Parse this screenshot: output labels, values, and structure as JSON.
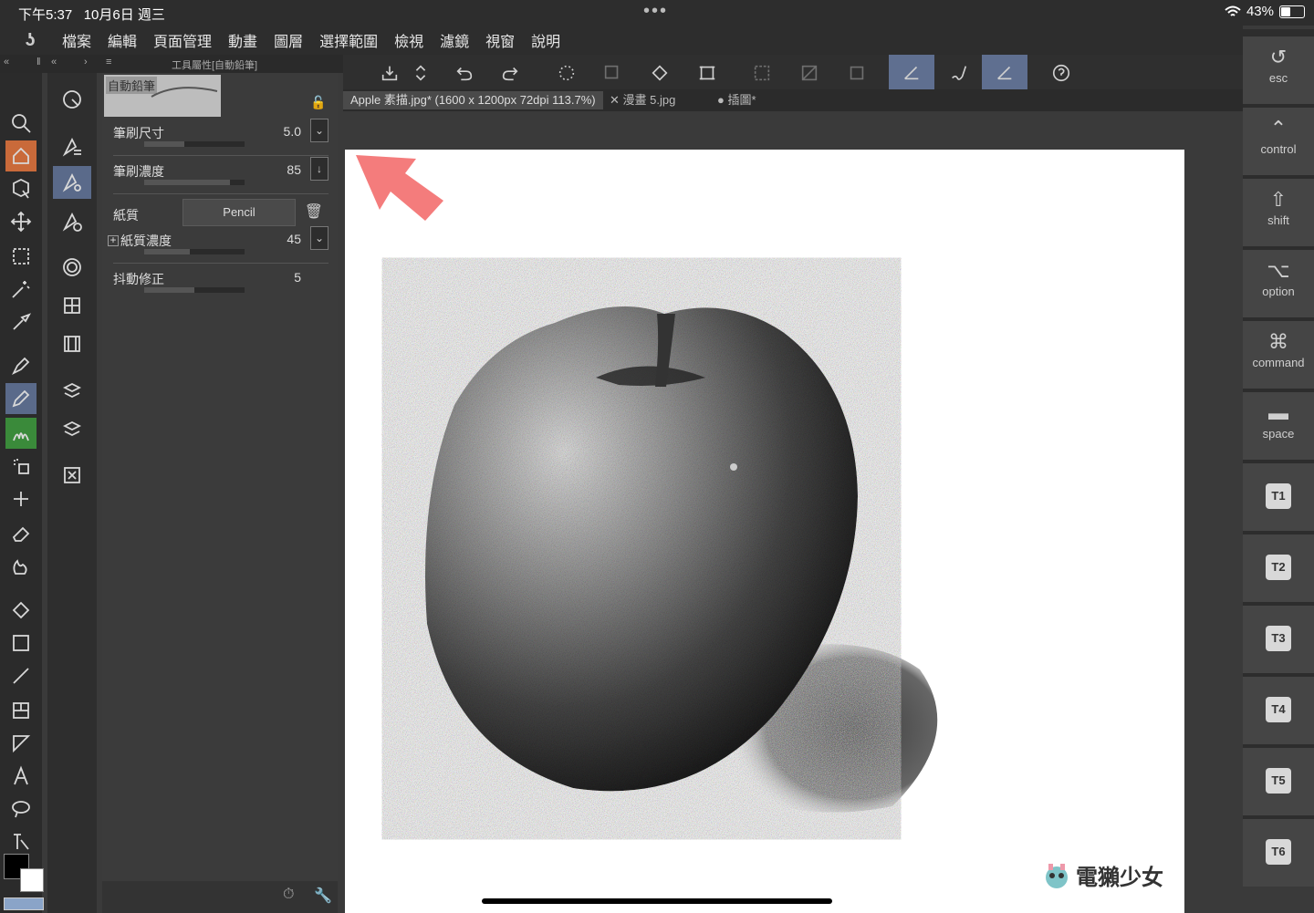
{
  "status_bar": {
    "time": "下午5:37",
    "date": "10月6日 週三",
    "battery": "43%"
  },
  "menu": [
    "檔案",
    "編輯",
    "頁面管理",
    "動畫",
    "圖層",
    "選擇範圍",
    "檢視",
    "濾鏡",
    "視窗",
    "說明"
  ],
  "tool_property": {
    "header": "工具屬性[自動鉛筆]",
    "preset_name": "自動鉛筆",
    "brush_size": {
      "label": "筆刷尺寸",
      "value": "5.0",
      "fill": 0.4
    },
    "brush_density": {
      "label": "筆刷濃度",
      "value": "85",
      "fill": 0.85
    },
    "paper": {
      "label": "紙質",
      "value": "Pencil"
    },
    "paper_density": {
      "label": "紙質濃度",
      "value": "45",
      "fill": 0.45
    },
    "stabilization": {
      "label": "抖動修正",
      "value": "5",
      "fill": 0.5
    }
  },
  "tabs": [
    {
      "label": "Apple 素描.jpg* (1600 x 1200px 72dpi 113.7%)",
      "active": true
    },
    {
      "label": "漫畫 5.jpg",
      "active": false
    },
    {
      "label": "插圖*",
      "active": false
    }
  ],
  "right_keys": [
    {
      "label": "esc",
      "icon": "↺"
    },
    {
      "label": "control",
      "icon": "⌃"
    },
    {
      "label": "shift",
      "icon": "⇧"
    },
    {
      "label": "option",
      "icon": "⌥"
    },
    {
      "label": "command",
      "icon": "⌘"
    },
    {
      "label": "space",
      "icon": "▬"
    },
    {
      "label": "",
      "icon": "T1"
    },
    {
      "label": "",
      "icon": "T2"
    },
    {
      "label": "",
      "icon": "T3"
    },
    {
      "label": "",
      "icon": "T4"
    },
    {
      "label": "",
      "icon": "T5"
    },
    {
      "label": "",
      "icon": "T6"
    }
  ],
  "watermark": "電獺少女",
  "colors": {
    "selection": "#5a6a8a",
    "arrow": "#f47c7c"
  }
}
